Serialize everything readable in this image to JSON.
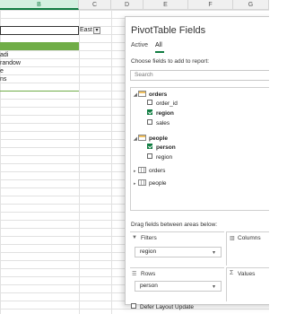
{
  "sheet": {
    "columns": [
      "B",
      "C",
      "D",
      "E",
      "F",
      "G"
    ],
    "filter_value": "East",
    "filter_icon": "filter-dropdown-icon",
    "list_items": [
      "adi",
      "randow",
      "e",
      "ns"
    ]
  },
  "pivot": {
    "title": "PivotTable Fields",
    "tabs": [
      "Active",
      "All"
    ],
    "active_tab": "All",
    "choose_label": "Choose fields to add to report:",
    "search_placeholder": "Search",
    "tables": [
      {
        "name": "orders",
        "fields": [
          {
            "label": "order_id",
            "checked": false
          },
          {
            "label": "region",
            "checked": true
          },
          {
            "label": "sales",
            "checked": false
          }
        ]
      },
      {
        "name": "people",
        "fields": [
          {
            "label": "person",
            "checked": true
          },
          {
            "label": "region",
            "checked": false
          }
        ]
      }
    ],
    "collapsed_tables": [
      "orders",
      "people"
    ],
    "drag_label": "Drag fields between areas below:",
    "areas": {
      "filters": {
        "label": "Filters",
        "value": "region"
      },
      "columns": {
        "label": "Columns"
      },
      "rows": {
        "label": "Rows",
        "value": "person"
      },
      "values": {
        "label": "Values",
        "icon": "sigma-icon"
      }
    },
    "defer_label": "Defer Layout Update"
  }
}
